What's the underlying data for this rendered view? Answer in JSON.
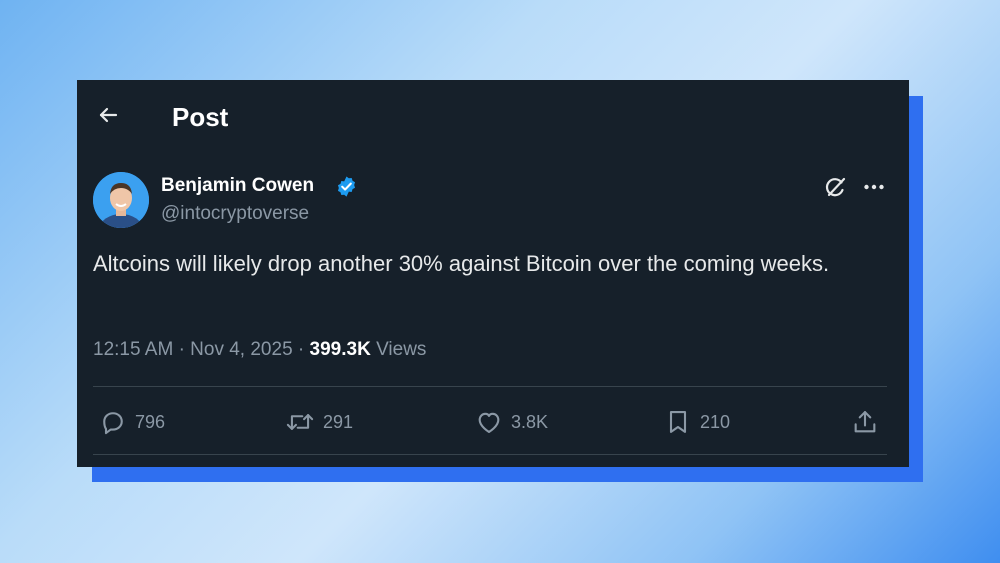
{
  "header": {
    "title": "Post",
    "back_icon": "arrow-left-icon"
  },
  "post": {
    "author_name": "Benjamin Cowen",
    "verified": true,
    "handle": "@intocryptoverse",
    "text": "Altcoins will likely drop another 30% against Bitcoin over the coming weeks.",
    "time": "12:15 AM",
    "date": "Nov 4, 2025",
    "separator": "·",
    "views_count": "399.3K",
    "views_label": "Views"
  },
  "actions": {
    "replies": "796",
    "reposts": "291",
    "likes": "3.8K",
    "bookmarks": "210"
  },
  "colors": {
    "card_bg": "#16202a",
    "text_primary": "#e7e9ea",
    "text_secondary": "#8b98a5",
    "verified_blue": "#1d9bf0",
    "shadow_blue": "#2f6ff0"
  }
}
